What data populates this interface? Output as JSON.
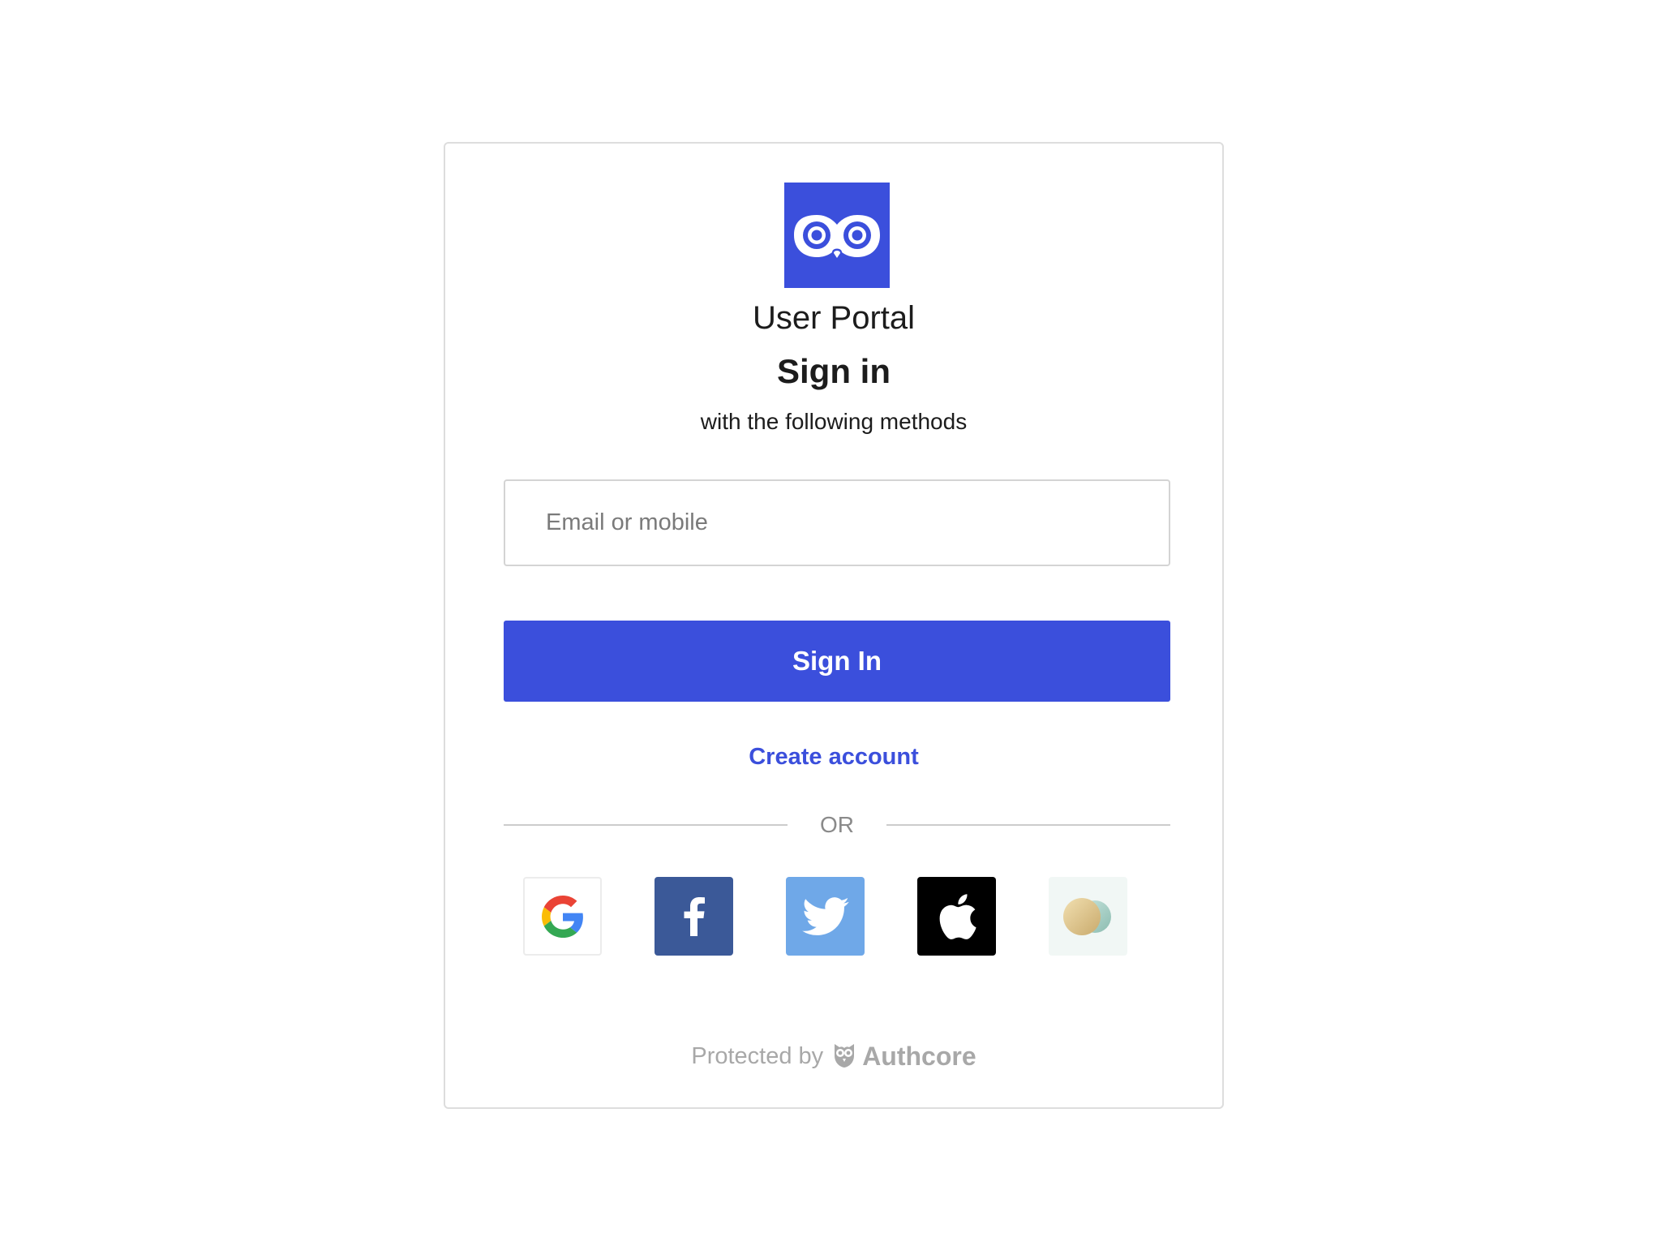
{
  "app": {
    "title": "User Portal",
    "logo_icon": "owl-logo-icon",
    "brand_color": "#3b4fdc"
  },
  "signin": {
    "heading": "Sign in",
    "subheading": "with the following methods",
    "email_placeholder": "Email or mobile",
    "email_value": "",
    "submit_label": "Sign In",
    "create_account_label": "Create account"
  },
  "divider": {
    "label": "OR"
  },
  "social_providers": [
    {
      "name": "google",
      "icon": "google-icon",
      "bg": "#ffffff"
    },
    {
      "name": "facebook",
      "icon": "facebook-icon",
      "bg": "#3b5998"
    },
    {
      "name": "twitter",
      "icon": "twitter-icon",
      "bg": "#6fa8e8"
    },
    {
      "name": "apple",
      "icon": "apple-icon",
      "bg": "#000000"
    },
    {
      "name": "other",
      "icon": "matters-icon",
      "bg": "#f1f7f5"
    }
  ],
  "footer": {
    "protected_by": "Protected by",
    "brand": "Authcore",
    "brand_icon": "authcore-owl-icon"
  }
}
